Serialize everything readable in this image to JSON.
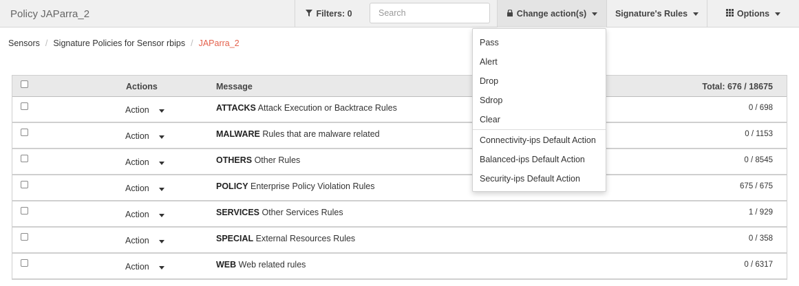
{
  "header": {
    "title": "Policy JAParra_2",
    "filters_label": "Filters: 0",
    "search_placeholder": "Search",
    "change_actions_label": "Change action(s)",
    "signature_rules_label": "Signature's Rules",
    "options_label": "Options"
  },
  "breadcrumb": [
    "Sensors",
    "Signature Policies for Sensor rbips",
    "JAParra_2"
  ],
  "table": {
    "columns": {
      "actions": "Actions",
      "message": "Message",
      "total": "Total: 676 / 18675"
    },
    "rows": [
      {
        "action": "Action",
        "category": "ATTACKS",
        "description": "Attack Execution or Backtrace Rules",
        "count": "0 / 698"
      },
      {
        "action": "Action",
        "category": "MALWARE",
        "description": "Rules that are malware related",
        "count": "0 / 1153"
      },
      {
        "action": "Action",
        "category": "OTHERS",
        "description": "Other Rules",
        "count": "0 / 8545"
      },
      {
        "action": "Action",
        "category": "POLICY",
        "description": "Enterprise Policy Violation Rules",
        "count": "675 / 675"
      },
      {
        "action": "Action",
        "category": "SERVICES",
        "description": "Other Services Rules",
        "count": "1 / 929"
      },
      {
        "action": "Action",
        "category": "SPECIAL",
        "description": "External Resources Rules",
        "count": "0 / 358"
      },
      {
        "action": "Action",
        "category": "WEB",
        "description": "Web related rules",
        "count": "0 / 6317"
      }
    ]
  },
  "dropdown": {
    "items": [
      "Pass",
      "Alert",
      "Drop",
      "Sdrop",
      "Clear"
    ],
    "default_actions": [
      "Connectivity-ips Default Action",
      "Balanced-ips Default Action",
      "Security-ips Default Action"
    ]
  },
  "icons": {
    "filter": "filter-icon",
    "lock": "lock-icon",
    "options": "grid-icon"
  }
}
